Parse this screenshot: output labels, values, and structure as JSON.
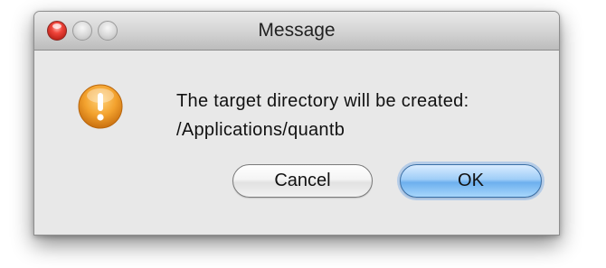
{
  "window": {
    "title": "Message"
  },
  "dialog": {
    "icon": "warning-exclamation-icon",
    "message_line1": "The target directory will be created:",
    "message_line2": "/Applications/quantb"
  },
  "buttons": {
    "cancel_label": "Cancel",
    "ok_label": "OK"
  },
  "colors": {
    "accent": "#6db0ee",
    "warning": "#f0a030"
  }
}
